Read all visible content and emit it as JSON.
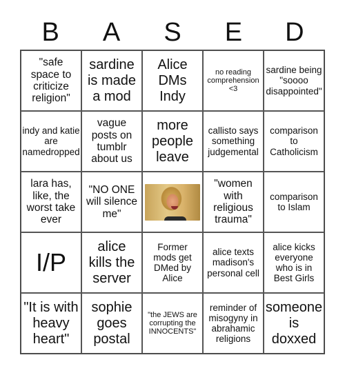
{
  "header": {
    "letters": [
      "B",
      "A",
      "S",
      "E",
      "D"
    ]
  },
  "board": {
    "rows": [
      [
        {
          "text": "\"safe space to criticize religion\"",
          "size": "fs-m"
        },
        {
          "text": "sardine is made a mod",
          "size": "fs-l"
        },
        {
          "text": "Alice DMs Indy",
          "size": "fs-l"
        },
        {
          "text": "no reading comprehension <3",
          "size": "fs-xs"
        },
        {
          "text": "sardine being \"soooo disappointed\"",
          "size": "fs-s"
        }
      ],
      [
        {
          "text": "indy and katie are namedropped",
          "size": "fs-s"
        },
        {
          "text": "vague posts on tumblr about us",
          "size": "fs-m"
        },
        {
          "text": "more people leave",
          "size": "fs-l"
        },
        {
          "text": "callisto says something judgemental",
          "size": "fs-s"
        },
        {
          "text": "comparison to Catholicism",
          "size": "fs-s"
        }
      ],
      [
        {
          "text": "lara has, like, the worst take ever",
          "size": "fs-m"
        },
        {
          "text": "\"NO ONE will silence me\"",
          "size": "fs-m"
        },
        {
          "text": "",
          "size": "free",
          "image": "crying-person-photo"
        },
        {
          "text": "\"women with religious trauma\"",
          "size": "fs-m"
        },
        {
          "text": "comparison to Islam",
          "size": "fs-s"
        }
      ],
      [
        {
          "text": "I/P",
          "size": "fs-xl"
        },
        {
          "text": "alice kills the server",
          "size": "fs-l"
        },
        {
          "text": "Former mods get DMed by Alice",
          "size": "fs-s"
        },
        {
          "text": "alice texts madison's personal cell",
          "size": "fs-s"
        },
        {
          "text": "alice kicks everyone who is in Best Girls",
          "size": "fs-s"
        }
      ],
      [
        {
          "text": "\"It is with heavy heart\"",
          "size": "fs-l"
        },
        {
          "text": "sophie goes postal",
          "size": "fs-l"
        },
        {
          "text": "\"the JEWS are corrupting the INNOCENTS\"",
          "size": "fs-xs"
        },
        {
          "text": "reminder of misogyny in abrahamic religions",
          "size": "fs-s"
        },
        {
          "text": "someone is doxxed",
          "size": "fs-l"
        }
      ]
    ]
  }
}
